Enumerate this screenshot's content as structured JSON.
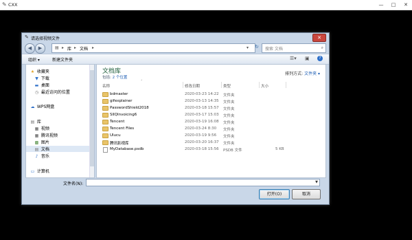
{
  "window": {
    "title": "CXX"
  },
  "dialog": {
    "title": "请选择视频文件",
    "breadcrumb": [
      "库",
      "文档"
    ],
    "search_placeholder": "搜索 文档",
    "toolbar": {
      "organize": "组织 ▾",
      "new_folder": "新建文件夹"
    },
    "sidebar": [
      {
        "label": "收藏夹",
        "icon": "star-icon",
        "type": "group"
      },
      {
        "label": "下载",
        "icon": "download-icon",
        "type": "item"
      },
      {
        "label": "桌面",
        "icon": "desktop-icon",
        "type": "item"
      },
      {
        "label": "最近访问的位置",
        "icon": "recent-icon",
        "type": "item"
      },
      {
        "label": "WPS网盘",
        "icon": "cloud-icon",
        "type": "group"
      },
      {
        "label": "库",
        "icon": "library-icon",
        "type": "group"
      },
      {
        "label": "视频",
        "icon": "video-icon",
        "type": "item"
      },
      {
        "label": "腾讯视频",
        "icon": "tencent-video-icon",
        "type": "item"
      },
      {
        "label": "图片",
        "icon": "pictures-icon",
        "type": "item"
      },
      {
        "label": "文档",
        "icon": "documents-icon",
        "type": "item",
        "selected": true
      },
      {
        "label": "音乐",
        "icon": "music-icon",
        "type": "item"
      },
      {
        "label": "计算机",
        "icon": "computer-icon",
        "type": "group"
      }
    ],
    "library": {
      "title": "文档库",
      "subtitle_prefix": "包括:",
      "subtitle_count": "2 个位置",
      "arrange_label": "排列方式:",
      "arrange_value": "文件夹 ▾"
    },
    "columns": {
      "name": "名称",
      "date": "修改日期",
      "type": "类型",
      "size": "大小"
    },
    "files": [
      {
        "name": "bdmaster",
        "date": "2020-03-23 14:22",
        "type": "文件夹",
        "size": "",
        "kind": "folder"
      },
      {
        "name": "gifexplainer",
        "date": "2020-03-13 14:35",
        "type": "文件夹",
        "size": "",
        "kind": "folder"
      },
      {
        "name": "PasswordShield2018",
        "date": "2020-03-18 15:57",
        "type": "文件夹",
        "size": "",
        "kind": "folder"
      },
      {
        "name": "SlIQInvoicing6",
        "date": "2020-03-17 15:03",
        "type": "文件夹",
        "size": "",
        "kind": "folder"
      },
      {
        "name": "Tencent",
        "date": "2020-03-19 16:08",
        "type": "文件夹",
        "size": "",
        "kind": "folder"
      },
      {
        "name": "Tencent Files",
        "date": "2020-03-24 8:30",
        "type": "文件夹",
        "size": "",
        "kind": "folder"
      },
      {
        "name": "Ulucu",
        "date": "2020-03-19 9:56",
        "type": "文件夹",
        "size": "",
        "kind": "folder"
      },
      {
        "name": "腾讯影视库",
        "date": "2020-03-20 16:37",
        "type": "文件夹",
        "size": "",
        "kind": "folder"
      },
      {
        "name": "MyDatabase.psdb",
        "date": "2020-03-18 15:56",
        "type": "PSDB 文件",
        "size": "5 KB",
        "kind": "file"
      }
    ],
    "filename_label": "文件名(N):",
    "filename_value": "",
    "buttons": {
      "open": "打开(O)",
      "cancel": "取消"
    }
  }
}
